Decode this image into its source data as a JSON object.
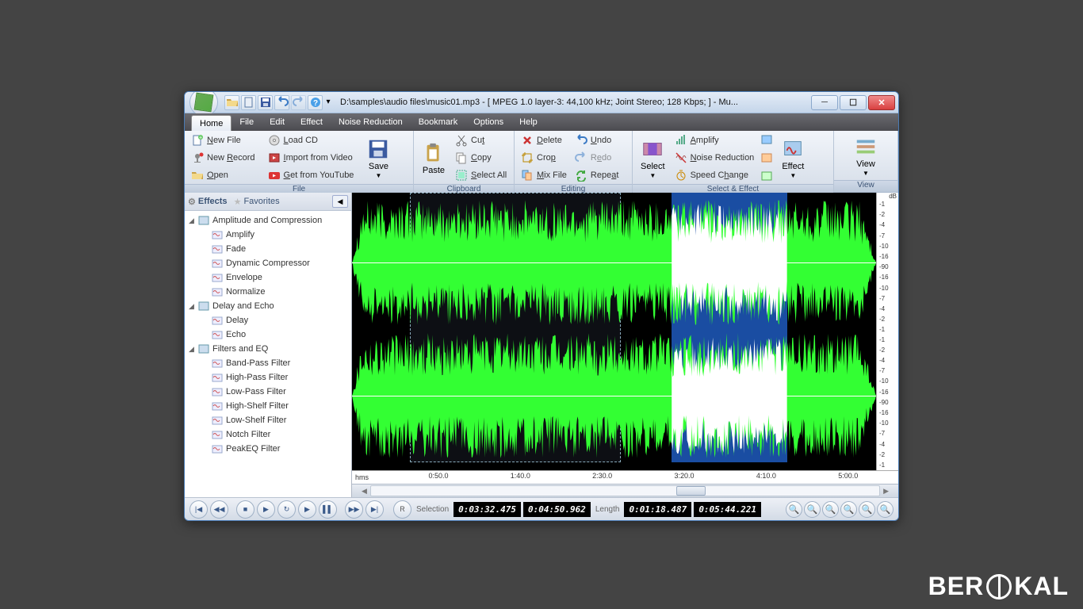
{
  "title": "D:\\samples\\audio files\\music01.mp3 - [ MPEG 1.0 layer-3: 44,100 kHz; Joint Stereo; 128 Kbps;  ] - Mu...",
  "menus": [
    "Home",
    "File",
    "Edit",
    "Effect",
    "Noise Reduction",
    "Bookmark",
    "Options",
    "Help"
  ],
  "ribbon": {
    "file": {
      "label": "File",
      "new_file": "New File",
      "new_record": "New Record",
      "open": "Open",
      "load_cd": "Load CD",
      "import_video": "Import from Video",
      "get_youtube": "Get from YouTube",
      "save": "Save"
    },
    "clipboard": {
      "label": "Clipboard",
      "paste": "Paste",
      "cut": "Cut",
      "copy": "Copy",
      "select_all": "Select All"
    },
    "editing": {
      "label": "Editing",
      "delete": "Delete",
      "crop": "Crop",
      "mix_file": "Mix File",
      "undo": "Undo",
      "redo": "Redo",
      "repeat": "Repeat"
    },
    "select_effect": {
      "label": "Select & Effect",
      "select": "Select",
      "amplify": "Amplify",
      "noise_reduction": "Noise Reduction",
      "speed_change": "Speed Change",
      "effect": "Effect"
    },
    "view": {
      "label": "View",
      "view": "View"
    }
  },
  "sidebar": {
    "effects_tab": "Effects",
    "favorites_tab": "Favorites",
    "groups": [
      {
        "name": "Amplitude and Compression",
        "items": [
          "Amplify",
          "Fade",
          "Dynamic Compressor",
          "Envelope",
          "Normalize"
        ]
      },
      {
        "name": "Delay and Echo",
        "items": [
          "Delay",
          "Echo"
        ]
      },
      {
        "name": "Filters and EQ",
        "items": [
          "Band-Pass Filter",
          "High-Pass Filter",
          "Low-Pass Filter",
          "High-Shelf Filter",
          "Low-Shelf Filter",
          "Notch Filter",
          "PeakEQ Filter"
        ]
      }
    ]
  },
  "db_scale": {
    "unit": "dB",
    "ticks": [
      "-1",
      "-2",
      "-4",
      "-7",
      "-10",
      "-16",
      "-90",
      "-16",
      "-10",
      "-7",
      "-4",
      "-2",
      "-1"
    ]
  },
  "timeline": {
    "unit": "hms",
    "marks": [
      "0:50.0",
      "1:40.0",
      "2:30.0",
      "3:20.0",
      "4:10.0",
      "5:00.0"
    ]
  },
  "status": {
    "selection_label": "Selection",
    "sel_start": "0:03:32.475",
    "sel_end": "0:04:50.962",
    "length_label": "Length",
    "len_sel": "0:01:18.487",
    "len_total": "0:05:44.221"
  },
  "watermark": "BEROKAL"
}
